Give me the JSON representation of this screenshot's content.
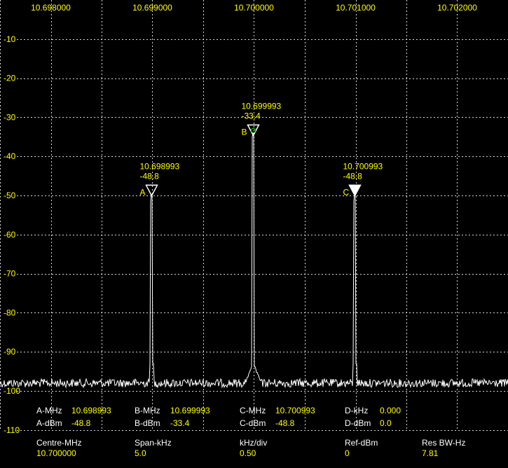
{
  "colors": {
    "background": "#000000",
    "trace": "#ffffff",
    "grid": "#ffffff",
    "value_text": "#ffff00",
    "label_text": "#ffffff",
    "peak_dot": "#00c000"
  },
  "chart_data": {
    "type": "line",
    "x_unit": "MHz",
    "y_unit": "dBm",
    "xlim": [
      10.6975,
      10.7025
    ],
    "ylim": [
      -110,
      0
    ],
    "x_ticks": [
      "10.698000",
      "10.699000",
      "10.700000",
      "10.701000",
      "10.702000"
    ],
    "y_ticks": [
      "-10",
      "-20",
      "-30",
      "-40",
      "-50",
      "-60",
      "-70",
      "-80",
      "-90",
      "-100",
      "-110"
    ],
    "grid": true,
    "noise_floor": -98,
    "peaks": [
      {
        "freq": 10.698993,
        "level": -48.8
      },
      {
        "freq": 10.699993,
        "level": -33.4
      },
      {
        "freq": 10.700993,
        "level": -48.8
      }
    ],
    "markers": [
      {
        "letter": "A",
        "freq": 10.698993,
        "freq_text": "10.698993",
        "level_text": "-48.8",
        "filled": false
      },
      {
        "letter": "B",
        "freq": 10.699993,
        "freq_text": "10.699993",
        "level_text": "-33.4",
        "filled": false
      },
      {
        "letter": "C",
        "freq": 10.700993,
        "freq_text": "10.700993",
        "level_text": "-48.8",
        "filled": true
      }
    ]
  },
  "readouts": {
    "a_mhz": {
      "label": "A-MHz",
      "value": "10.698993"
    },
    "a_dbm": {
      "label": "A-dBm",
      "value": "-48.8"
    },
    "b_mhz": {
      "label": "B-MHz",
      "value": "10.699993"
    },
    "b_dbm": {
      "label": "B-dBm",
      "value": "-33.4"
    },
    "c_mhz": {
      "label": "C-MHz",
      "value": "10.700993"
    },
    "c_dbm": {
      "label": "C-dBm",
      "value": "-48.8"
    },
    "d_khz": {
      "label": "D-kHz",
      "value": "0.000"
    },
    "d_dbm": {
      "label": "D-dBm",
      "value": "0.0"
    }
  },
  "settings": {
    "centre": {
      "label": "Centre-MHz",
      "value": "10.700000"
    },
    "span": {
      "label": "Span-kHz",
      "value": "5.0"
    },
    "div": {
      "label": "kHz/div",
      "value": "0.50"
    },
    "ref": {
      "label": "Ref-dBm",
      "value": "0"
    },
    "rbw": {
      "label": "Res BW-Hz",
      "value": "7.81"
    }
  }
}
